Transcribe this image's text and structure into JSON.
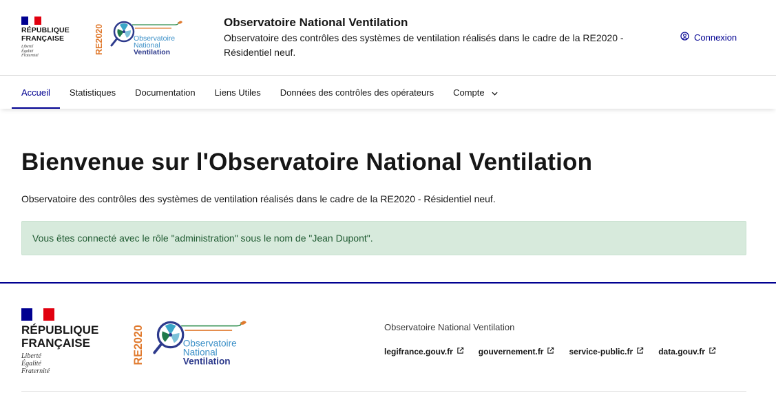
{
  "header": {
    "republique": {
      "title_line1": "RÉPUBLIQUE",
      "title_line2": "FRANÇAISE",
      "motto_line1": "Liberté",
      "motto_line2": "Égalité",
      "motto_line3": "Fraternité"
    },
    "logo": {
      "re_label": "RE2020",
      "line1": "Observatoire",
      "line2": "National",
      "line3": "Ventilation"
    },
    "service_title": "Observatoire National Ventilation",
    "service_tagline": "Observatoire des contrôles des systèmes de ventilation réalisés dans le cadre de la RE2020 - Résidentiel neuf.",
    "login_label": "Connexion"
  },
  "nav": {
    "items": [
      {
        "label": "Accueil",
        "active": true
      },
      {
        "label": "Statistiques"
      },
      {
        "label": "Documentation"
      },
      {
        "label": "Liens Utiles"
      },
      {
        "label": "Données des contrôles des opérateurs"
      },
      {
        "label": "Compte"
      }
    ]
  },
  "main": {
    "title": "Bienvenue sur l'Observatoire National Ventilation",
    "lead": "Observatoire des contrôles des systèmes de ventilation réalisés dans le cadre de la RE2020 - Résidentiel neuf.",
    "alert": "Vous êtes connecté avec le rôle \"administration\" sous le nom de \"Jean Dupont\"."
  },
  "footer": {
    "description": "Observatoire National Ventilation",
    "links": [
      {
        "label": "legifrance.gouv.fr"
      },
      {
        "label": "gouvernement.fr"
      },
      {
        "label": "service-public.fr"
      },
      {
        "label": "data.gouv.fr"
      }
    ]
  },
  "colors": {
    "blue_france": "#000091",
    "red_marianne": "#e1000f",
    "success_bg": "#d7eadc",
    "success_text": "#1f5a31",
    "re2020_orange": "#e07a2e",
    "re2020_green": "#2c8c4b",
    "logo_teal": "#3a8fc7"
  },
  "icons": {
    "login": "user-circle-icon",
    "dropdown": "chevron-down-icon",
    "external": "external-link-icon"
  }
}
